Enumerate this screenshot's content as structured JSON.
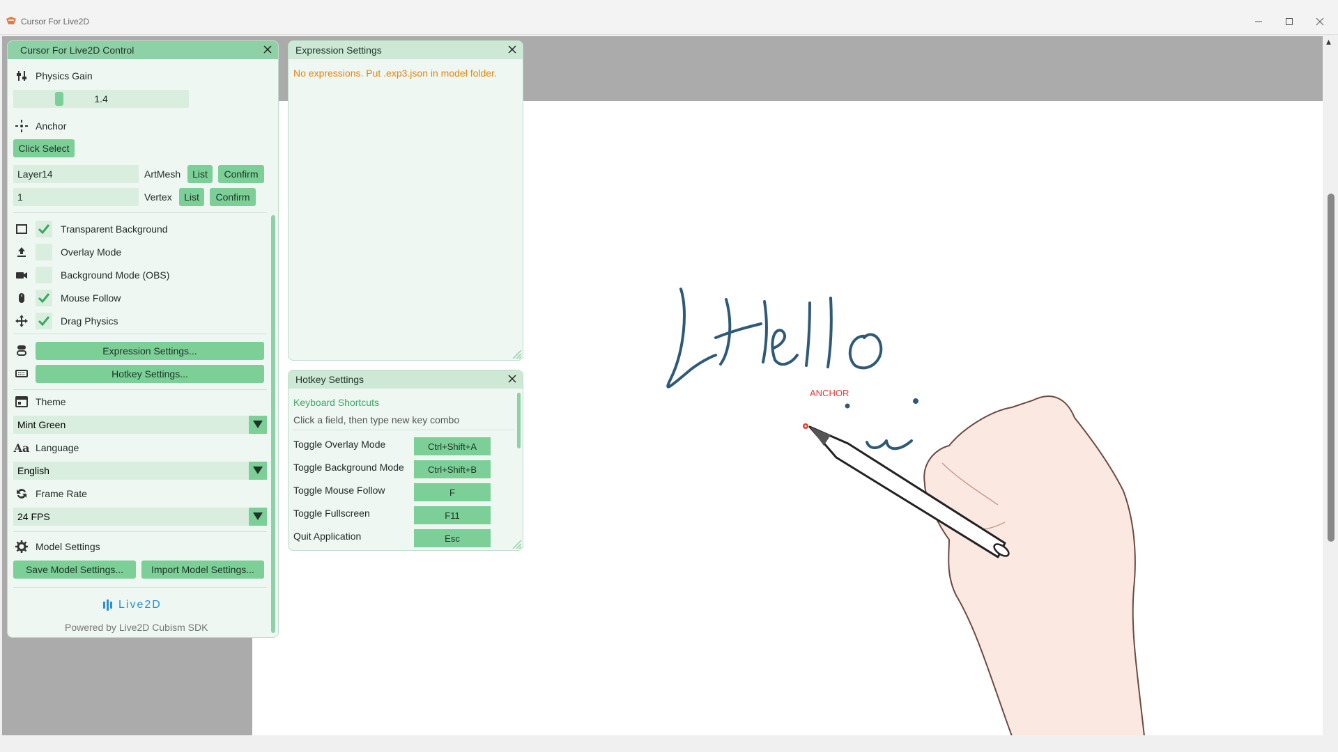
{
  "window": {
    "title": "Cursor For Live2D",
    "minimize": "—",
    "maximize": "☐",
    "close": "✕"
  },
  "control_panel": {
    "title": "Cursor For Live2D Control",
    "physics_gain": {
      "label": "Physics Gain",
      "value": "1.4",
      "level": 0.25
    },
    "anchor": {
      "label": "Anchor",
      "click_select": "Click Select"
    },
    "artmesh": {
      "value": "Layer14",
      "label": "ArtMesh",
      "list": "List",
      "confirm": "Confirm"
    },
    "vertex": {
      "value": "1",
      "label": "Vertex",
      "list": "List",
      "confirm": "Confirm"
    },
    "toggles": [
      {
        "label": "Transparent Background",
        "checked": true,
        "icon": "square-icon"
      },
      {
        "label": "Overlay Mode",
        "checked": false,
        "icon": "upload-icon"
      },
      {
        "label": "Background Mode (OBS)",
        "checked": false,
        "icon": "camera-icon"
      },
      {
        "label": "Mouse Follow",
        "checked": true,
        "icon": "mouse-icon"
      },
      {
        "label": "Drag Physics",
        "checked": true,
        "icon": "move-icon"
      }
    ],
    "expression_settings_btn": "Expression Settings...",
    "hotkey_settings_btn": "Hotkey Settings...",
    "theme": {
      "label": "Theme",
      "value": "Mint Green"
    },
    "language": {
      "label": "Language",
      "value": "English"
    },
    "frame_rate": {
      "label": "Frame Rate",
      "value": "24 FPS"
    },
    "model_settings": {
      "label": "Model Settings",
      "save": "Save Model Settings...",
      "import": "Import Model Settings..."
    },
    "logo_text": "Live2D",
    "powered_by": "Powered by Live2D Cubism SDK"
  },
  "expression_panel": {
    "title": "Expression Settings",
    "message": "No expressions. Put .exp3.json in model folder."
  },
  "hotkey_panel": {
    "title": "Hotkey Settings",
    "section": "Keyboard Shortcuts",
    "hint": "Click a field, then type new key combo",
    "items": [
      {
        "label": "Toggle Overlay Mode",
        "key": "Ctrl+Shift+A"
      },
      {
        "label": "Toggle Background Mode",
        "key": "Ctrl+Shift+B"
      },
      {
        "label": "Toggle Mouse Follow",
        "key": "F"
      },
      {
        "label": "Toggle Fullscreen",
        "key": "F11"
      },
      {
        "label": "Quit Application",
        "key": "Esc"
      }
    ]
  },
  "canvas": {
    "handwriting": "Hello",
    "anchor_label": "ANCHOR"
  },
  "colors": {
    "accent": "#7ccf97",
    "warning_text": "#e8850c",
    "anchor_red": "#e53935"
  }
}
